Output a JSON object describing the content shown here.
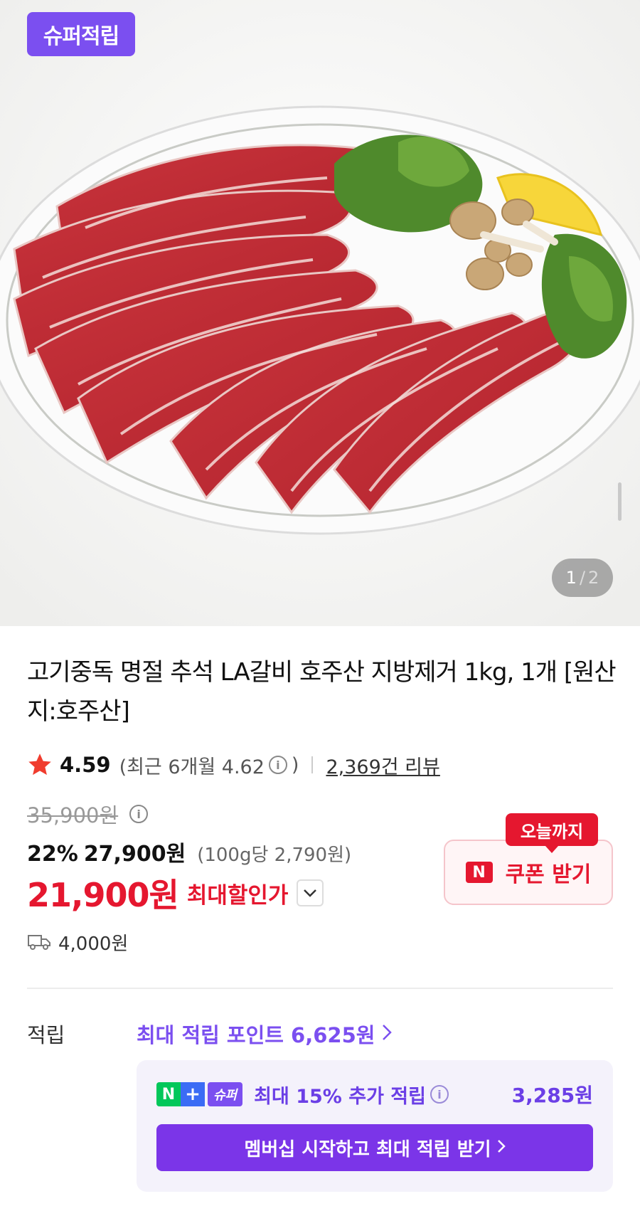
{
  "hero": {
    "badge": "슈퍼적립",
    "counter_current": "1",
    "counter_sep": "/",
    "counter_total": "2"
  },
  "product": {
    "title": "고기중독 명절 추석 LA갈비 호주산 지방제거 1kg, 1개 [원산지:호주산]",
    "rating": "4.59",
    "recent_rating": "(최근 6개월 4.62",
    "recent_close": ")",
    "review_count": "2,369건 리뷰"
  },
  "price": {
    "original": "35,900원",
    "discount_rate": "22%",
    "sale": "27,900원",
    "unit_price": "(100g당 2,790원)",
    "max_discount_price": "21,900원",
    "max_discount_label": "최대할인가",
    "coupon_tag": "오늘까지",
    "coupon_logo": "N",
    "coupon_button": "쿠폰 받기",
    "shipping": "4,000원"
  },
  "points": {
    "label": "적립",
    "max_points": "최대 적립 포인트 6,625원",
    "np_n": "N",
    "np_plus": "+",
    "np_super": "슈퍼",
    "extra_text": "최대 15% 추가 적립",
    "extra_amount": "3,285원",
    "membership_button": "멤버십 시작하고 최대 적립 받기"
  },
  "colors": {
    "brand_purple": "#7b4ff0",
    "sale_red": "#e5172f",
    "naver_green": "#03c75a"
  }
}
